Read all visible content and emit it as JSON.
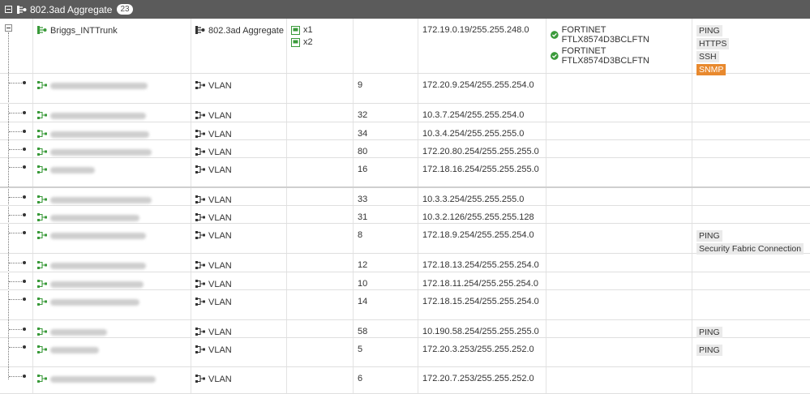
{
  "group": {
    "title": "802.3ad Aggregate",
    "count": "23"
  },
  "colors": {
    "header_bg": "#5b5b5b",
    "icon_green": "#3a9a3a",
    "snmp_orange": "#e8892e"
  },
  "trunk": {
    "name": "Briggs_INTTrunk",
    "type": "802.3ad Aggregate",
    "members": [
      "x1",
      "x2"
    ],
    "ip": "172.19.0.19/255.255.248.0",
    "fabric": [
      "FORTINET FTLX8574D3BCLFTN",
      "FORTINET FTLX8574D3BCLFTN"
    ],
    "access": [
      "PING",
      "HTTPS",
      "SSH",
      "SNMP"
    ]
  },
  "vlans": [
    {
      "type": "VLAN",
      "vlan_id": "9",
      "ip": "172.20.9.254/255.255.254.0",
      "access": []
    },
    {
      "type": "VLAN",
      "vlan_id": "32",
      "ip": "10.3.7.254/255.255.254.0",
      "access": []
    },
    {
      "type": "VLAN",
      "vlan_id": "34",
      "ip": "10.3.4.254/255.255.255.0",
      "access": []
    },
    {
      "type": "VLAN",
      "vlan_id": "80",
      "ip": "172.20.80.254/255.255.255.0",
      "access": []
    },
    {
      "type": "VLAN",
      "vlan_id": "16",
      "ip": "172.18.16.254/255.255.255.0",
      "access": []
    },
    {
      "type": "VLAN",
      "vlan_id": "33",
      "ip": "10.3.3.254/255.255.255.0",
      "access": []
    },
    {
      "type": "VLAN",
      "vlan_id": "31",
      "ip": "10.3.2.126/255.255.255.128",
      "access": []
    },
    {
      "type": "VLAN",
      "vlan_id": "8",
      "ip": "172.18.9.254/255.255.254.0",
      "access": [
        "PING",
        "Security Fabric Connection"
      ]
    },
    {
      "type": "VLAN",
      "vlan_id": "12",
      "ip": "172.18.13.254/255.255.254.0",
      "access": []
    },
    {
      "type": "VLAN",
      "vlan_id": "10",
      "ip": "172.18.11.254/255.255.254.0",
      "access": []
    },
    {
      "type": "VLAN",
      "vlan_id": "14",
      "ip": "172.18.15.254/255.255.254.0",
      "access": []
    },
    {
      "type": "VLAN",
      "vlan_id": "58",
      "ip": "10.190.58.254/255.255.255.0",
      "access": [
        "PING"
      ]
    },
    {
      "type": "VLAN",
      "vlan_id": "5",
      "ip": "172.20.3.253/255.255.252.0",
      "access": [
        "PING"
      ]
    },
    {
      "type": "VLAN",
      "vlan_id": "6",
      "ip": "172.20.7.253/255.255.252.0",
      "access": []
    }
  ]
}
